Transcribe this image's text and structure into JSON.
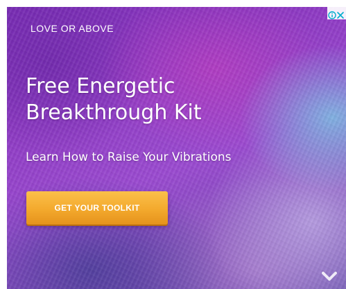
{
  "ad": {
    "brand": "LOVE OR ABOVE",
    "headline_line1": "Free Energetic",
    "headline_line2": "Breakthrough Kit",
    "subheadline": "Learn How to Raise Your Vibrations",
    "cta_label": "GET YOUR TOOLKIT",
    "chevron_icon": "chevron-down-icon"
  },
  "adchoices": {
    "info_icon": "info-icon",
    "close_icon": "close-icon"
  },
  "colors": {
    "background_primary": "#8f3bc4",
    "cta_orange": "#f3a92d",
    "text": "#ffffff",
    "adchoices_blue": "#00aecd"
  }
}
